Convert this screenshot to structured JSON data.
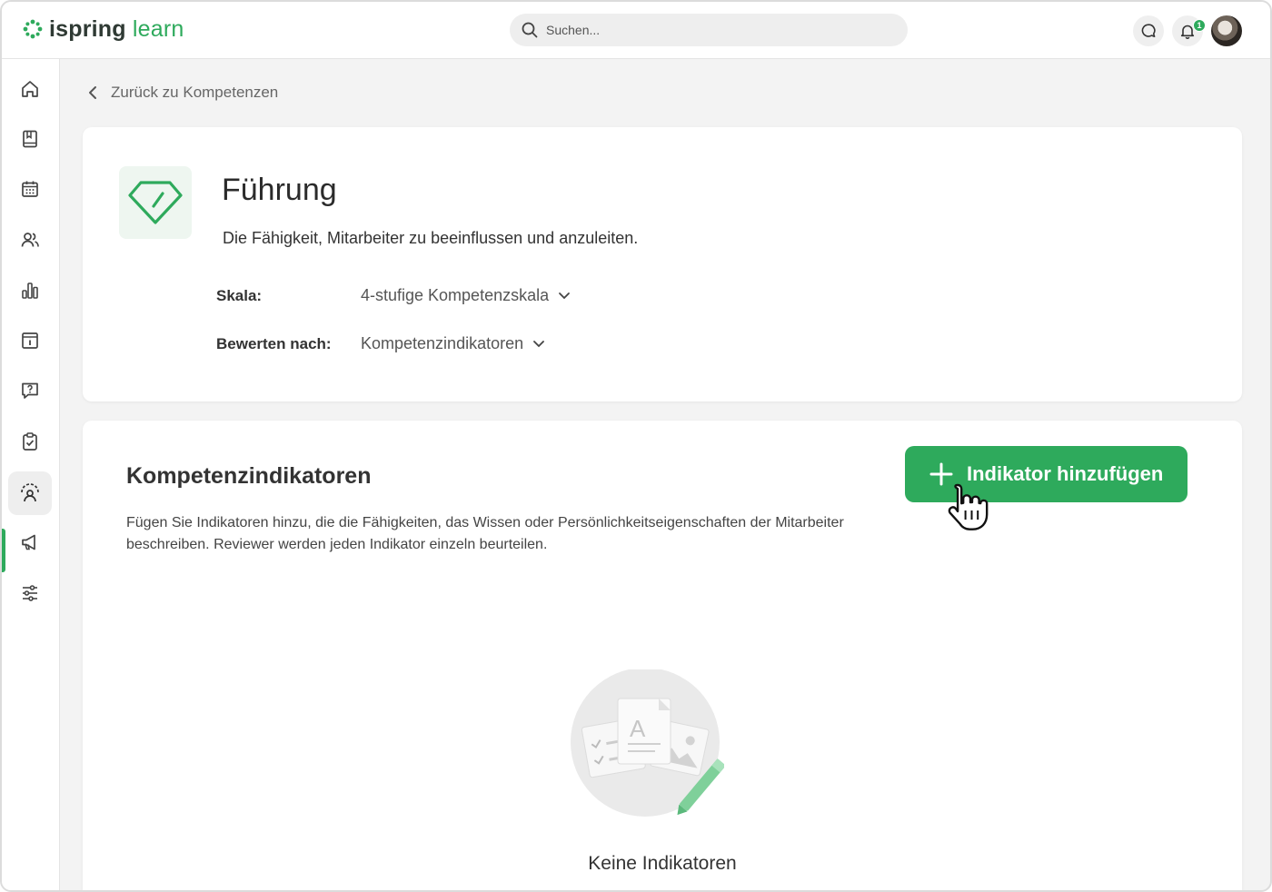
{
  "app": {
    "logo_primary": "ispring",
    "logo_secondary": "learn",
    "brand_color": "#2eaa5c"
  },
  "search": {
    "placeholder": "Suchen..."
  },
  "header": {
    "notification_count": "1",
    "icons": [
      "chat-icon",
      "bell-icon",
      "avatar"
    ]
  },
  "sidebar": {
    "items": [
      {
        "icon": "home-icon"
      },
      {
        "icon": "book-icon"
      },
      {
        "icon": "calendar-icon"
      },
      {
        "icon": "users-icon"
      },
      {
        "icon": "bar-chart-icon"
      },
      {
        "icon": "info-icon"
      },
      {
        "icon": "question-icon"
      },
      {
        "icon": "clipboard-check-icon"
      },
      {
        "icon": "competency-icon",
        "active": true
      },
      {
        "icon": "megaphone-icon"
      },
      {
        "icon": "settings-sliders-icon"
      }
    ]
  },
  "breadcrumb": {
    "back_label": "Zurück zu Kompetenzen"
  },
  "competency": {
    "title": "Führung",
    "description": "Die Fähigkeit, Mitarbeiter zu beeinflussen und anzuleiten.",
    "scale_label": "Skala:",
    "scale_value": "4-stufige Kompetenzskala",
    "rate_by_label": "Bewerten nach:",
    "rate_by_value": "Kompetenzindikatoren"
  },
  "indicators": {
    "title": "Kompetenzindikatoren",
    "description": "Fügen Sie Indikatoren hinzu, die die Fähigkeiten, das Wissen oder Persönlichkeitseigenschaften der Mitarbeiter beschreiben. Reviewer werden jeden Indikator einzeln beurteilen.",
    "add_button": "Indikator hinzufügen",
    "empty_text": "Keine Indikatoren"
  }
}
